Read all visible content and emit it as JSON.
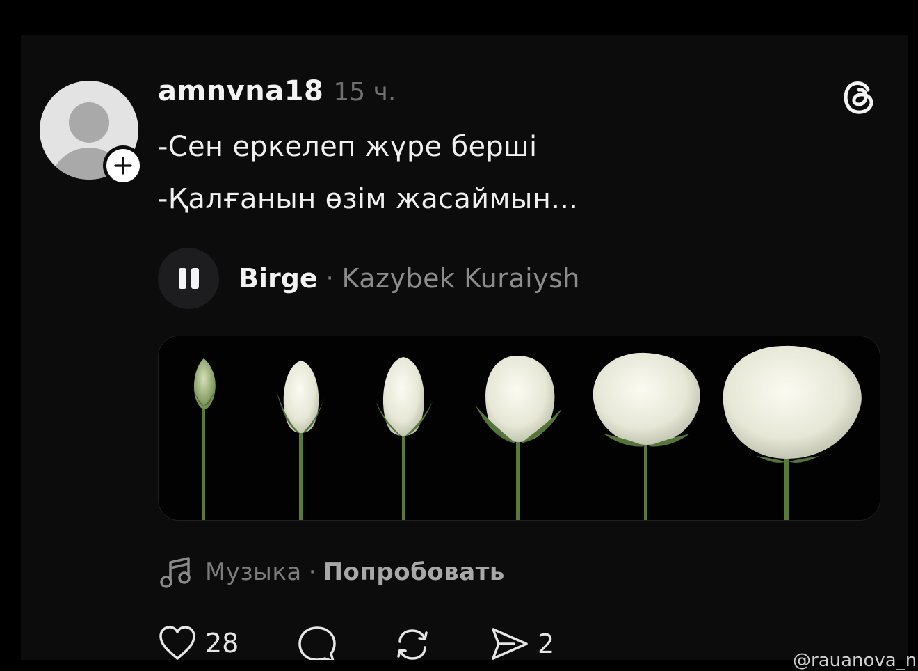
{
  "post": {
    "username": "amnvna18",
    "time": "15 ч.",
    "lines": [
      "-Сен еркелеп жүре берші",
      "-Қалғанын өзім жасаймын..."
    ]
  },
  "music": {
    "title": "Birge",
    "separator": "·",
    "artist": "Kazybek Kuraiysh",
    "state": "playing"
  },
  "image": {
    "description_icon": "white-roses-blooming-sequence-image",
    "rose_count": 6
  },
  "promo": {
    "label": "Музыка",
    "separator": "·",
    "link": "Попробовать"
  },
  "actions": {
    "likes": "28",
    "shares": "2"
  },
  "watermark": "@rauanova_n",
  "colors": {
    "background": "#000000",
    "card": "#0c0c0d",
    "text": "#f0f0f0",
    "muted": "#7c7c7c"
  }
}
